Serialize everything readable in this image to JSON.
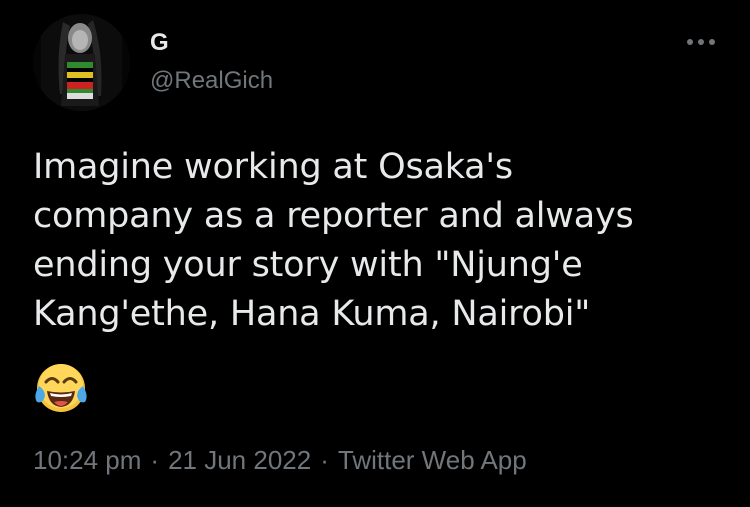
{
  "tweet": {
    "author": {
      "display_name": "G",
      "handle": "@RealGich",
      "avatar_icon": "profile-avatar"
    },
    "more_icon": "more-options-icon",
    "text_lines": [
      "Imagine working at Osaka's",
      "company as a reporter and always",
      "ending your story with \"Njung'e",
      "Kang'ethe, Hana Kuma, Nairobi\""
    ],
    "emoji": "face-with-tears-of-joy",
    "meta": {
      "time": "10:24 pm",
      "separator": "·",
      "date": "21 Jun 2022",
      "source": "Twitter Web App"
    }
  },
  "colors": {
    "background": "#000000",
    "primary_text": "#e7e9ea",
    "secondary_text": "#71767b"
  }
}
